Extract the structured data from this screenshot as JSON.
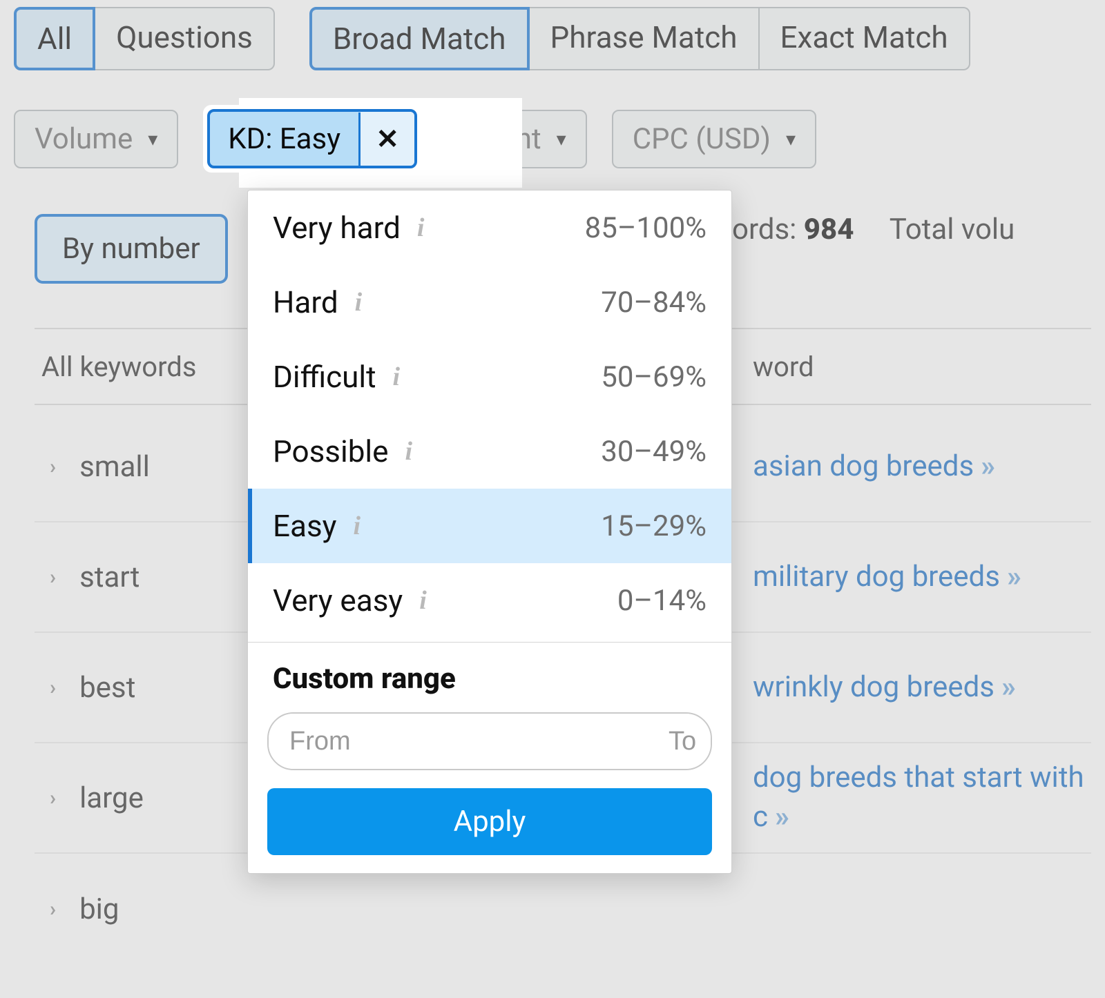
{
  "tabs": {
    "group1": [
      {
        "label": "All",
        "active": true
      },
      {
        "label": "Questions",
        "active": false
      }
    ],
    "group2": [
      {
        "label": "Broad Match",
        "active": true
      },
      {
        "label": "Phrase Match",
        "active": false
      },
      {
        "label": "Exact Match",
        "active": false
      }
    ]
  },
  "filters": {
    "volume": "Volume",
    "kd_label": "KD: Easy",
    "intent": "Intent",
    "cpc": "CPC (USD)"
  },
  "by_number": "By number",
  "stats": {
    "prefix": "ords: ",
    "count": "984",
    "total_prefix": "Total volu"
  },
  "table": {
    "col_left": "All keywords",
    "col_right": "word"
  },
  "keyword_groups": [
    {
      "label": "small",
      "kw": "asian dog breeds"
    },
    {
      "label": "start",
      "kw": "military dog breeds"
    },
    {
      "label": "best",
      "kw": "wrinkly dog breeds"
    },
    {
      "label": "large",
      "kw": "dog breeds that start with c"
    },
    {
      "label": "big",
      "kw": ""
    }
  ],
  "dropdown": {
    "items": [
      {
        "label": "Very hard",
        "range": "85–100%",
        "selected": false
      },
      {
        "label": "Hard",
        "range": "70–84%",
        "selected": false
      },
      {
        "label": "Difficult",
        "range": "50–69%",
        "selected": false
      },
      {
        "label": "Possible",
        "range": "30–49%",
        "selected": false
      },
      {
        "label": "Easy",
        "range": "15–29%",
        "selected": true
      },
      {
        "label": "Very easy",
        "range": "0–14%",
        "selected": false
      }
    ],
    "custom_title": "Custom range",
    "from_ph": "From",
    "to_ph": "To",
    "apply": "Apply"
  }
}
